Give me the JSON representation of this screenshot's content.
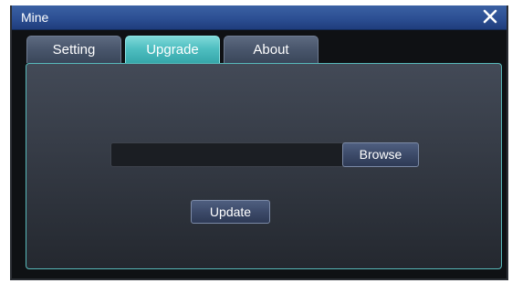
{
  "window": {
    "title": "Mine",
    "close_icon": "close-icon"
  },
  "tabs": [
    {
      "label": "Setting",
      "active": false
    },
    {
      "label": "Upgrade",
      "active": true
    },
    {
      "label": "About",
      "active": false
    }
  ],
  "upgrade": {
    "file_path_value": "",
    "browse_label": "Browse",
    "update_label": "Update"
  },
  "colors": {
    "titlebar": "#2c4f93",
    "active_tab": "#4fbfc1",
    "inactive_tab": "#48556b",
    "panel_border": "#58b9ba"
  }
}
